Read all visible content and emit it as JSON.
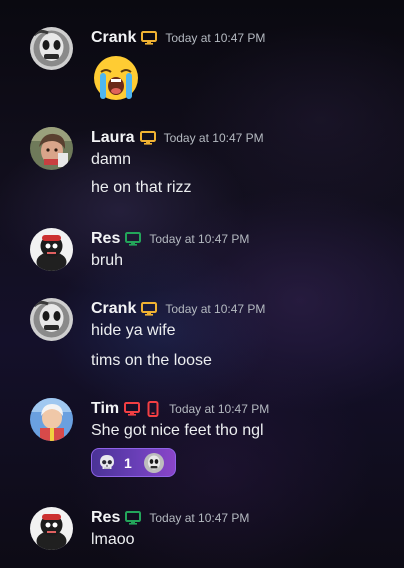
{
  "messages": [
    {
      "author": "Crank",
      "author_color": "#ffffff",
      "avatar": "skull-mask-avatar",
      "devices": [
        "desktop-icon"
      ],
      "status_color": "#f0b232",
      "timestamp": "Today at 10:47 PM",
      "emoji": "loudly-crying-face-emoji",
      "lines": []
    },
    {
      "author": "Laura",
      "avatar": "portrait-avatar",
      "devices": [
        "desktop-icon"
      ],
      "status_color": "#f0b232",
      "timestamp": "Today at 10:47 PM",
      "lines": [
        "damn",
        "he on that rizz"
      ]
    },
    {
      "author": "Res",
      "avatar": "figure-avatar",
      "devices": [
        "desktop-icon"
      ],
      "status_color": "#23a55a",
      "timestamp": "Today at 10:47 PM",
      "lines": [
        "bruh"
      ]
    },
    {
      "author": "Crank",
      "avatar": "skull-mask-avatar",
      "devices": [
        "desktop-icon"
      ],
      "status_color": "#f0b232",
      "timestamp": "Today at 10:47 PM",
      "lines": [
        "hide ya wife",
        "tims on the loose"
      ]
    },
    {
      "author": "Tim",
      "avatar": "colorful-avatar",
      "devices": [
        "desktop-icon",
        "mobile-icon"
      ],
      "status_color": "#f23f43",
      "timestamp": "Today at 10:47 PM",
      "lines": [
        "She got nice feet tho ngl"
      ],
      "reaction": {
        "emoji": "skull-emoji",
        "count": "1",
        "reactor_avatar": "skull-mask-avatar"
      }
    },
    {
      "author": "Res",
      "avatar": "figure-avatar",
      "devices": [
        "desktop-icon"
      ],
      "status_color": "#23a55a",
      "timestamp": "Today at 10:47 PM",
      "lines": [
        "lmaoo"
      ]
    }
  ],
  "colors": {
    "idle": "#f0b232",
    "online": "#23a55a",
    "dnd": "#f23f43",
    "reaction_bg": "#5b3aa8",
    "timestamp": "#b5bac1"
  }
}
